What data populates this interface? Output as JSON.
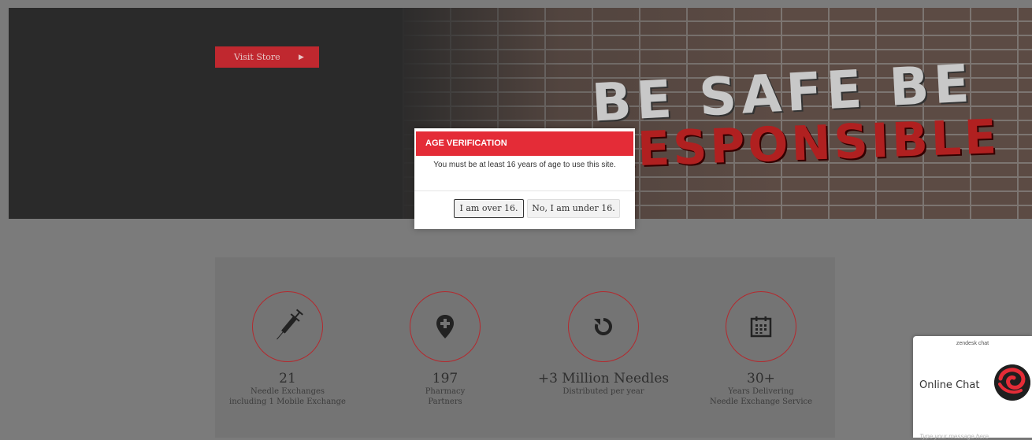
{
  "hero": {
    "visit_store_label": "Visit Store",
    "visit_store_arrow": "▶",
    "graffiti_line1": "BE SAFE BE",
    "graffiti_line2": "RESPONSIBLE"
  },
  "stats": [
    {
      "icon": "syringe-icon",
      "number": "21",
      "line1": "Needle Exchanges",
      "line2": "including 1 Mobile Exchange"
    },
    {
      "icon": "map-pin-plus-icon",
      "number": "197",
      "line1": "Pharmacy",
      "line2": "Partners"
    },
    {
      "icon": "refresh-icon",
      "number": "+3 Million Needles",
      "line1": "Distributed per year",
      "line2": ""
    },
    {
      "icon": "calendar-icon",
      "number": "30+",
      "line1": "Years Delivering",
      "line2": "Needle Exchange Service"
    }
  ],
  "modal": {
    "title": "AGE VERIFICATION",
    "message": "You must be at least 16 years of age to use this site.",
    "over_label": "I am over 16.",
    "under_label": "No, I am under 16."
  },
  "chat": {
    "brand": "zendesk chat",
    "title": "Online Chat",
    "placeholder": "Type your message here"
  },
  "colors": {
    "accent": "#e42c37",
    "hero_bg": "#2a2a2a",
    "page_bg": "#7b7b7b"
  }
}
